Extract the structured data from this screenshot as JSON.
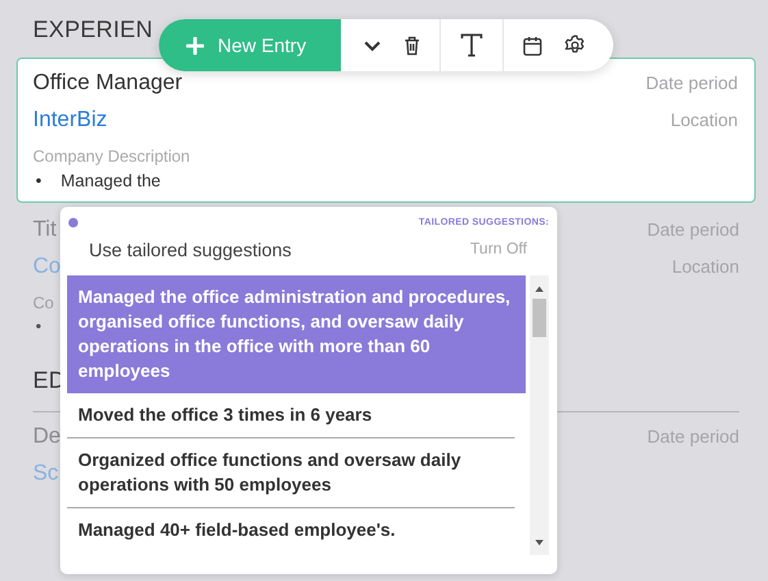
{
  "section_title": "EXPERIEN",
  "toolbar": {
    "new_entry_label": "New Entry"
  },
  "active_entry": {
    "title": "Office Manager",
    "company": "InterBiz",
    "date": "Date period",
    "location": "Location",
    "description_placeholder": "Company Description",
    "bullet": "•",
    "bullet_text": "Managed the"
  },
  "second_entry": {
    "title": "Tit",
    "company": "Co",
    "date": "Date period",
    "location": "Location",
    "description": "Co",
    "bullet": "•"
  },
  "education": {
    "title": "ED",
    "degree": "De",
    "date": "Date period",
    "school": "Sc"
  },
  "suggestions": {
    "heading": "TAILORED SUGGESTIONS:",
    "toggle_label": "Use tailored suggestions",
    "toggle_action": "Turn Off",
    "items": [
      {
        "text": "Managed the office administration and procedures, organised office functions, and oversaw daily operations in the office with more than 60 employees",
        "selected": true
      },
      {
        "text": "Moved the office 3 times in 6 years",
        "selected": false
      },
      {
        "text": "Organized office functions and oversaw daily operations with 50 employees",
        "selected": false
      },
      {
        "text": "Managed 40+ field-based employee's.",
        "selected": false
      }
    ]
  }
}
